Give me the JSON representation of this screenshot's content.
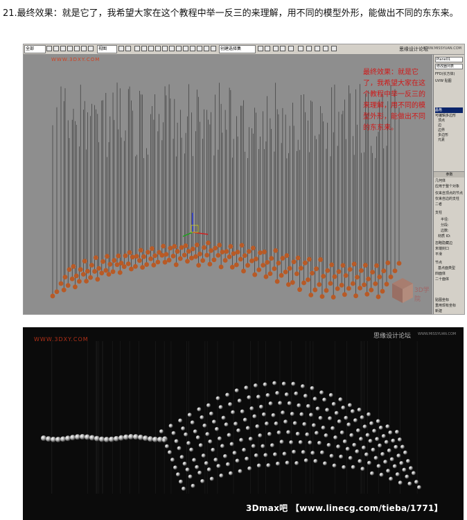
{
  "caption": {
    "text": "21.最终效果：就是它了，我希望大家在这个教程中举一反三的来理解，用不同的模型外形，能做出不同的东东来。"
  },
  "max_screenshot": {
    "toolbar": {
      "select_left": "全部",
      "select_view": "视图",
      "select_selection": "创建选择集",
      "title": "思缘设计论坛",
      "url": "WWW.MISSYUAN.COM"
    },
    "viewport": {
      "watermark": "WWW.3DXY.COM",
      "annotation": "最终效果：就是它了，我希望大家在这个教程中举一反三的来理解，用不同的模型外形，能做出不同的东东来。",
      "logo_text": "3D学院"
    },
    "command_panel": {
      "object_name": "Plane01",
      "modifier_list": "修改器列表",
      "ffd_item": "FFD(长方体)",
      "uvw_item": "UVW 贴图",
      "stack_head": "晶格",
      "stack_items": [
        "可编辑多边形",
        "顶点",
        "边",
        "边界",
        "多边形",
        "元素"
      ],
      "params_head": "参数",
      "geometry_label": "几何体",
      "apply_whole": "应用于整个对象",
      "radio_joints_only": "仅来自顶点的节点",
      "radio_struts_only": "仅来自边的支柱",
      "radio_both": "二者",
      "struts_label": "支柱",
      "radius_label": "半径:",
      "segments_label": "分段:",
      "sides_label": "边数:",
      "material_label": "材质 ID:",
      "ignore_hidden": "忽略隐藏边",
      "end_caps": "末端封口",
      "smooth": "平滑",
      "joints_label": "节点",
      "base_geo": "基点面类型",
      "tetra": "四面体",
      "icosa": "二十面体",
      "map_coords": "贴图坐标",
      "reuse": "重用现有坐标",
      "new": "新建"
    }
  },
  "render_screenshot": {
    "watermark": "WWW.3DXY.COM",
    "forum": "思缘设计论坛",
    "forum_url": "WWW.MISSYUAN.COM",
    "bottom_text": "3Dmax吧 【www.linecg.com/tieba/1771】"
  },
  "colors": {
    "sphere": "#b85a26",
    "viewport_bg": "#8e8e8e",
    "annotation": "#d01818",
    "render_bg": "#0b0b0b"
  }
}
